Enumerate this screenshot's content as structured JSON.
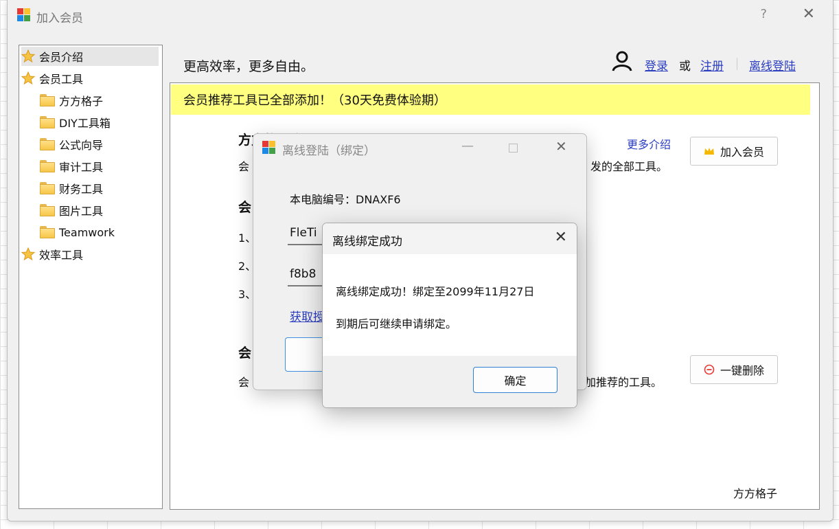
{
  "window": {
    "title": "加入会员",
    "help": "?",
    "close": "✕"
  },
  "sidebar": {
    "items": [
      {
        "label": "会员介绍",
        "icon": "star-icon"
      },
      {
        "label": "会员工具",
        "icon": "star-icon"
      },
      {
        "label": "方方格子",
        "icon": "folder-icon"
      },
      {
        "label": "DIY工具箱",
        "icon": "folder-icon"
      },
      {
        "label": "公式向导",
        "icon": "folder-icon"
      },
      {
        "label": "审计工具",
        "icon": "folder-icon"
      },
      {
        "label": "财务工具",
        "icon": "folder-icon"
      },
      {
        "label": "图片工具",
        "icon": "folder-icon"
      },
      {
        "label": "Teamwork",
        "icon": "folder-icon"
      },
      {
        "label": "效率工具",
        "icon": "star-icon"
      }
    ]
  },
  "header": {
    "slogan": "更高效率，更多自由。",
    "login": "登录",
    "or": "或",
    "register": "注册",
    "offline_login": "离线登陆"
  },
  "main": {
    "banner": "会员推荐工具已全部添加！（30天免费体验期）",
    "section1_title": "方方格子会员",
    "section1_text_left": "会",
    "section1_text_right": "发的全部工具。",
    "more_intro": "更多介绍",
    "join_button": "加入会员",
    "section2_title": "会",
    "step1": "1、",
    "step2": "2、",
    "step3": "3、",
    "section3_title": "会",
    "section3_text_left": "会",
    "section3_text_right": "加推荐的工具。",
    "delete_button": "一键删除",
    "footer_label": "方方格子"
  },
  "offline_dialog": {
    "title": "离线登陆（绑定）",
    "minimize": "—",
    "close": "✕",
    "machine_id": "本电脑编号：DNAXF6",
    "field1_value": "FleTi",
    "field2_value": "f8b8",
    "link": "获取授"
  },
  "message_box": {
    "title": "离线绑定成功",
    "close": "✕",
    "line1": "离线绑定成功！绑定至2099年11月27日",
    "line2": "到期后可继续申请绑定。",
    "ok": "确定"
  },
  "colors": {
    "banner": "#ffff80",
    "link": "#2a3cbf",
    "accent": "#2f7fd6"
  }
}
